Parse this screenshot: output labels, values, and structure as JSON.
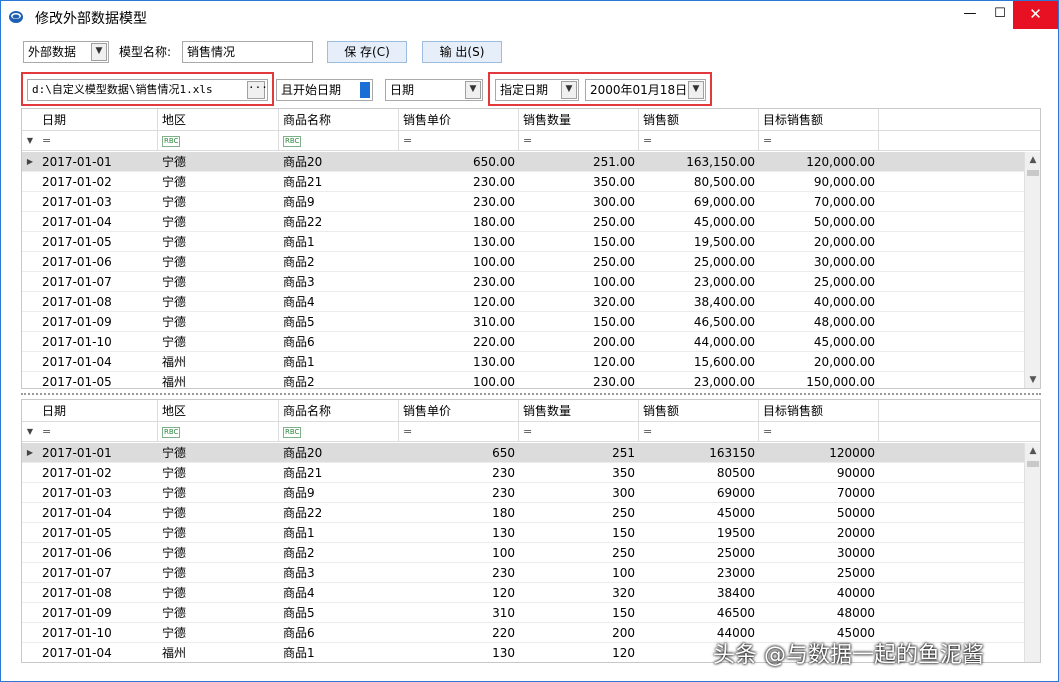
{
  "window": {
    "title": "修改外部数据模型",
    "min_label": "—",
    "max_label": "☐",
    "close_label": "✕"
  },
  "toolbar": {
    "source_type": "外部数据",
    "model_name_label": "模型名称:",
    "model_name_value": "销售情况",
    "save_label": "保 存(C)",
    "export_label": "输 出(S)",
    "file_path": "d:\\自定义模型数据\\销售情况1.xls",
    "ellipsis": "···",
    "start_date_toggle": "且开始日期",
    "date_field": "日期",
    "date_mode": "指定日期",
    "date_value": "2000年01月18日"
  },
  "columns": [
    "日期",
    "地区",
    "商品名称",
    "销售单价",
    "销售数量",
    "销售额",
    "目标销售额"
  ],
  "filter_icons": [
    "=",
    "rbc",
    "rbc",
    "=",
    "=",
    "=",
    "="
  ],
  "grid1_rows": [
    [
      "2017-01-01",
      "宁德",
      "商品20",
      "650.00",
      "251.00",
      "163,150.00",
      "120,000.00"
    ],
    [
      "2017-01-02",
      "宁德",
      "商品21",
      "230.00",
      "350.00",
      "80,500.00",
      "90,000.00"
    ],
    [
      "2017-01-03",
      "宁德",
      "商品9",
      "230.00",
      "300.00",
      "69,000.00",
      "70,000.00"
    ],
    [
      "2017-01-04",
      "宁德",
      "商品22",
      "180.00",
      "250.00",
      "45,000.00",
      "50,000.00"
    ],
    [
      "2017-01-05",
      "宁德",
      "商品1",
      "130.00",
      "150.00",
      "19,500.00",
      "20,000.00"
    ],
    [
      "2017-01-06",
      "宁德",
      "商品2",
      "100.00",
      "250.00",
      "25,000.00",
      "30,000.00"
    ],
    [
      "2017-01-07",
      "宁德",
      "商品3",
      "230.00",
      "100.00",
      "23,000.00",
      "25,000.00"
    ],
    [
      "2017-01-08",
      "宁德",
      "商品4",
      "120.00",
      "320.00",
      "38,400.00",
      "40,000.00"
    ],
    [
      "2017-01-09",
      "宁德",
      "商品5",
      "310.00",
      "150.00",
      "46,500.00",
      "48,000.00"
    ],
    [
      "2017-01-10",
      "宁德",
      "商品6",
      "220.00",
      "200.00",
      "44,000.00",
      "45,000.00"
    ],
    [
      "2017-01-04",
      "福州",
      "商品1",
      "130.00",
      "120.00",
      "15,600.00",
      "20,000.00"
    ],
    [
      "2017-01-05",
      "福州",
      "商品2",
      "100.00",
      "230.00",
      "23,000.00",
      "150,000.00"
    ]
  ],
  "grid2_rows": [
    [
      "2017-01-01",
      "宁德",
      "商品20",
      "650",
      "251",
      "163150",
      "120000"
    ],
    [
      "2017-01-02",
      "宁德",
      "商品21",
      "230",
      "350",
      "80500",
      "90000"
    ],
    [
      "2017-01-03",
      "宁德",
      "商品9",
      "230",
      "300",
      "69000",
      "70000"
    ],
    [
      "2017-01-04",
      "宁德",
      "商品22",
      "180",
      "250",
      "45000",
      "50000"
    ],
    [
      "2017-01-05",
      "宁德",
      "商品1",
      "130",
      "150",
      "19500",
      "20000"
    ],
    [
      "2017-01-06",
      "宁德",
      "商品2",
      "100",
      "250",
      "25000",
      "30000"
    ],
    [
      "2017-01-07",
      "宁德",
      "商品3",
      "230",
      "100",
      "23000",
      "25000"
    ],
    [
      "2017-01-08",
      "宁德",
      "商品4",
      "120",
      "320",
      "38400",
      "40000"
    ],
    [
      "2017-01-09",
      "宁德",
      "商品5",
      "310",
      "150",
      "46500",
      "48000"
    ],
    [
      "2017-01-10",
      "宁德",
      "商品6",
      "220",
      "200",
      "44000",
      "45000"
    ],
    [
      "2017-01-04",
      "福州",
      "商品1",
      "130",
      "120",
      "",
      ""
    ]
  ],
  "watermark": "头条 @与数据一起的鱼泥酱"
}
